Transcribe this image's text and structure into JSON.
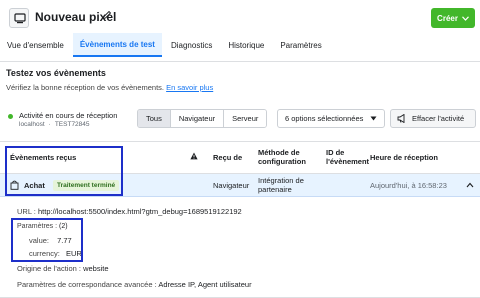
{
  "header": {
    "title": "Nouveau pixel",
    "create_label": "Créer",
    "tabs": [
      {
        "label": "Vue d'ensemble"
      },
      {
        "label": "Évènements de test"
      },
      {
        "label": "Diagnostics"
      },
      {
        "label": "Historique"
      },
      {
        "label": "Paramètres"
      }
    ]
  },
  "section": {
    "title": "Testez vos évènements",
    "description": "Vérifiez la bonne réception de vos évènements.",
    "learn_more": "En savoir plus"
  },
  "status": {
    "text": "Activité en cours de réception",
    "host": "localhost",
    "separator": "·",
    "test_code": "TEST72845"
  },
  "filters": {
    "segments": [
      "Tous",
      "Navigateur",
      "Serveur"
    ],
    "options_label": "6 options sélectionnées",
    "clear_label": "Effacer l'activité"
  },
  "table": {
    "headers": {
      "events": "Évènements reçus",
      "received_by": "Reçu de",
      "method": "Méthode de configuration",
      "event_id": "ID de l'évènement",
      "time": "Heure de réception"
    },
    "row": {
      "event": "Achat",
      "status": "Traitement terminé",
      "received_by": "Navigateur",
      "method": "Intégration de partenaire",
      "time": "Aujourd'hui, à 16:58:23"
    }
  },
  "detail": {
    "url_label": "URL :",
    "url": "http://localhost:5500/index.html?gtm_debug=1689519122192",
    "params_label": "Paramètres :",
    "params_count": "(2)",
    "value_label": "value:",
    "value": "7.77",
    "currency_label": "currency:",
    "currency": "EUR",
    "origin_label": "Origine de l'action :",
    "origin": "website",
    "advanced_label": "Paramètres de correspondance avancée :",
    "advanced": "Adresse IP, Agent utilisateur"
  },
  "colors": {
    "accent": "#1877f2",
    "create_green": "#42b72a",
    "highlight_box": "#1d2fc9",
    "selected_row": "#e7f3ff"
  },
  "icons": [
    "pixel-icon",
    "pencil-icon",
    "chevron-down-icon",
    "warning-icon",
    "shopping-bag-icon",
    "chevron-up-icon",
    "megaphone-icon",
    "status-dot-icon"
  ]
}
